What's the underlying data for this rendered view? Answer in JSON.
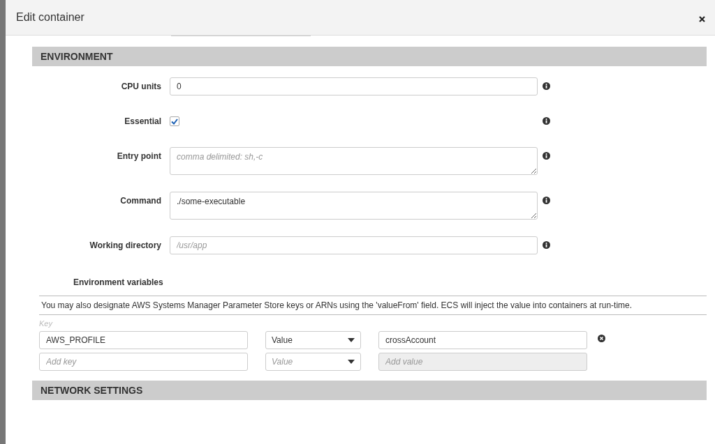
{
  "dialog": {
    "title": "Edit container"
  },
  "environment": {
    "title": "ENVIRONMENT",
    "fields": [
      {
        "kind": "input",
        "label": "CPU units",
        "value": "0"
      },
      {
        "kind": "checkbox",
        "label": "Essential",
        "checked": true
      },
      {
        "kind": "textarea",
        "label": "Entry point",
        "placeholder": "comma delimited: sh,-c"
      },
      {
        "kind": "multiline",
        "label": "Command",
        "value": "./some-executable"
      },
      {
        "kind": "input",
        "label": "Working directory",
        "placeholder": "/usr/app"
      }
    ]
  },
  "environment_variables": {
    "label": "Environment variables",
    "note": "You may also designate AWS Systems Manager Parameter Store keys or ARNs using the 'valueFrom' field. ECS will inject the value into containers at run-time.",
    "key_heading": "Key",
    "rows": [
      {
        "key": {
          "value": "AWS_PROFILE"
        },
        "type": {
          "value": "Value"
        },
        "value": {
          "value": "crossAccount",
          "disabled": false
        },
        "removable": true
      },
      {
        "key": {
          "placeholder": "Add key"
        },
        "type": {
          "placeholder": "Value"
        },
        "value": {
          "placeholder": "Add value",
          "disabled": true
        },
        "removable": false
      }
    ]
  },
  "network": {
    "title": "NETWORK SETTINGS"
  }
}
